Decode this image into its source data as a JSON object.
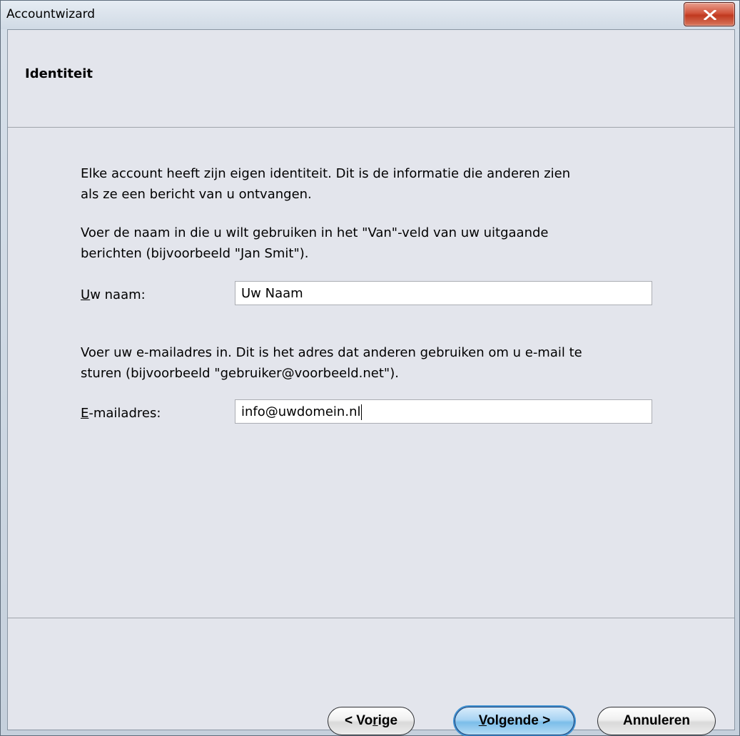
{
  "window": {
    "title": "Accountwizard"
  },
  "header": {
    "title": "Identiteit"
  },
  "content": {
    "intro": "Elke account heeft zijn eigen identiteit. Dit is de informatie die anderen zien\nals ze een bericht van u ontvangen.",
    "name_instructions": "Voer de naam in die u wilt gebruiken in het \"Van\"-veld van uw uitgaande\nberichten (bijvoorbeeld \"Jan Smit\").",
    "name_label_accel": "U",
    "name_label_rest": "w naam:",
    "name_value": "Uw Naam",
    "email_instructions": "Voer uw e-mailadres in. Dit is het adres dat anderen gebruiken om u e-mail te\nsturen (bijvoorbeeld \"gebruiker@voorbeeld.net\").",
    "email_label_accel": "E",
    "email_label_rest": "-mailadres:",
    "email_value": "info@uwdomein.nl"
  },
  "buttons": {
    "back_pre": "< Vo",
    "back_accel": "r",
    "back_post": "ige",
    "next_accel": "V",
    "next_post": "olgende >",
    "cancel": "Annuleren"
  },
  "colors": {
    "close_button": "#c0391f",
    "primary_button": "#7bbde9",
    "client_background": "#e3e5ec"
  }
}
